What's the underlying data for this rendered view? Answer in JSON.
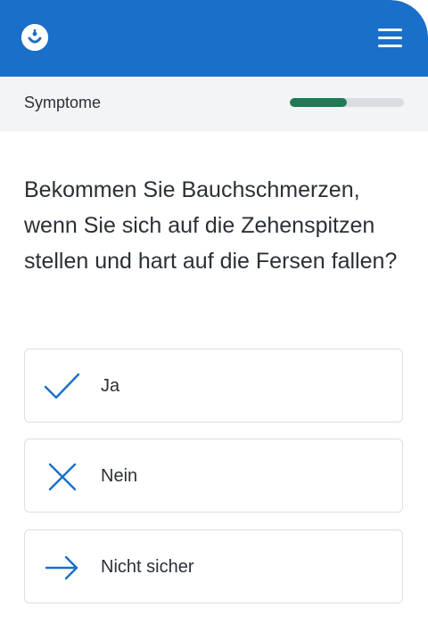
{
  "header": {
    "logo_icon": "baby-face-icon",
    "menu_icon": "hamburger-menu-icon",
    "bar_color": "#1a6fc9"
  },
  "subheader": {
    "section_label": "Symptome",
    "progress_fraction": 0.5,
    "progress_color": "#1f7a55"
  },
  "question": {
    "text": "Bekommen Sie Bauchschmerzen, wenn Sie sich auf die Zehenspitzen stellen und hart auf die Fersen fallen?"
  },
  "options": [
    {
      "label": "Ja",
      "icon": "checkmark-icon"
    },
    {
      "label": "Nein",
      "icon": "x-icon"
    },
    {
      "label": "Nicht sicher",
      "icon": "arrow-right-icon"
    }
  ],
  "accent_color": "#1a6fc9"
}
